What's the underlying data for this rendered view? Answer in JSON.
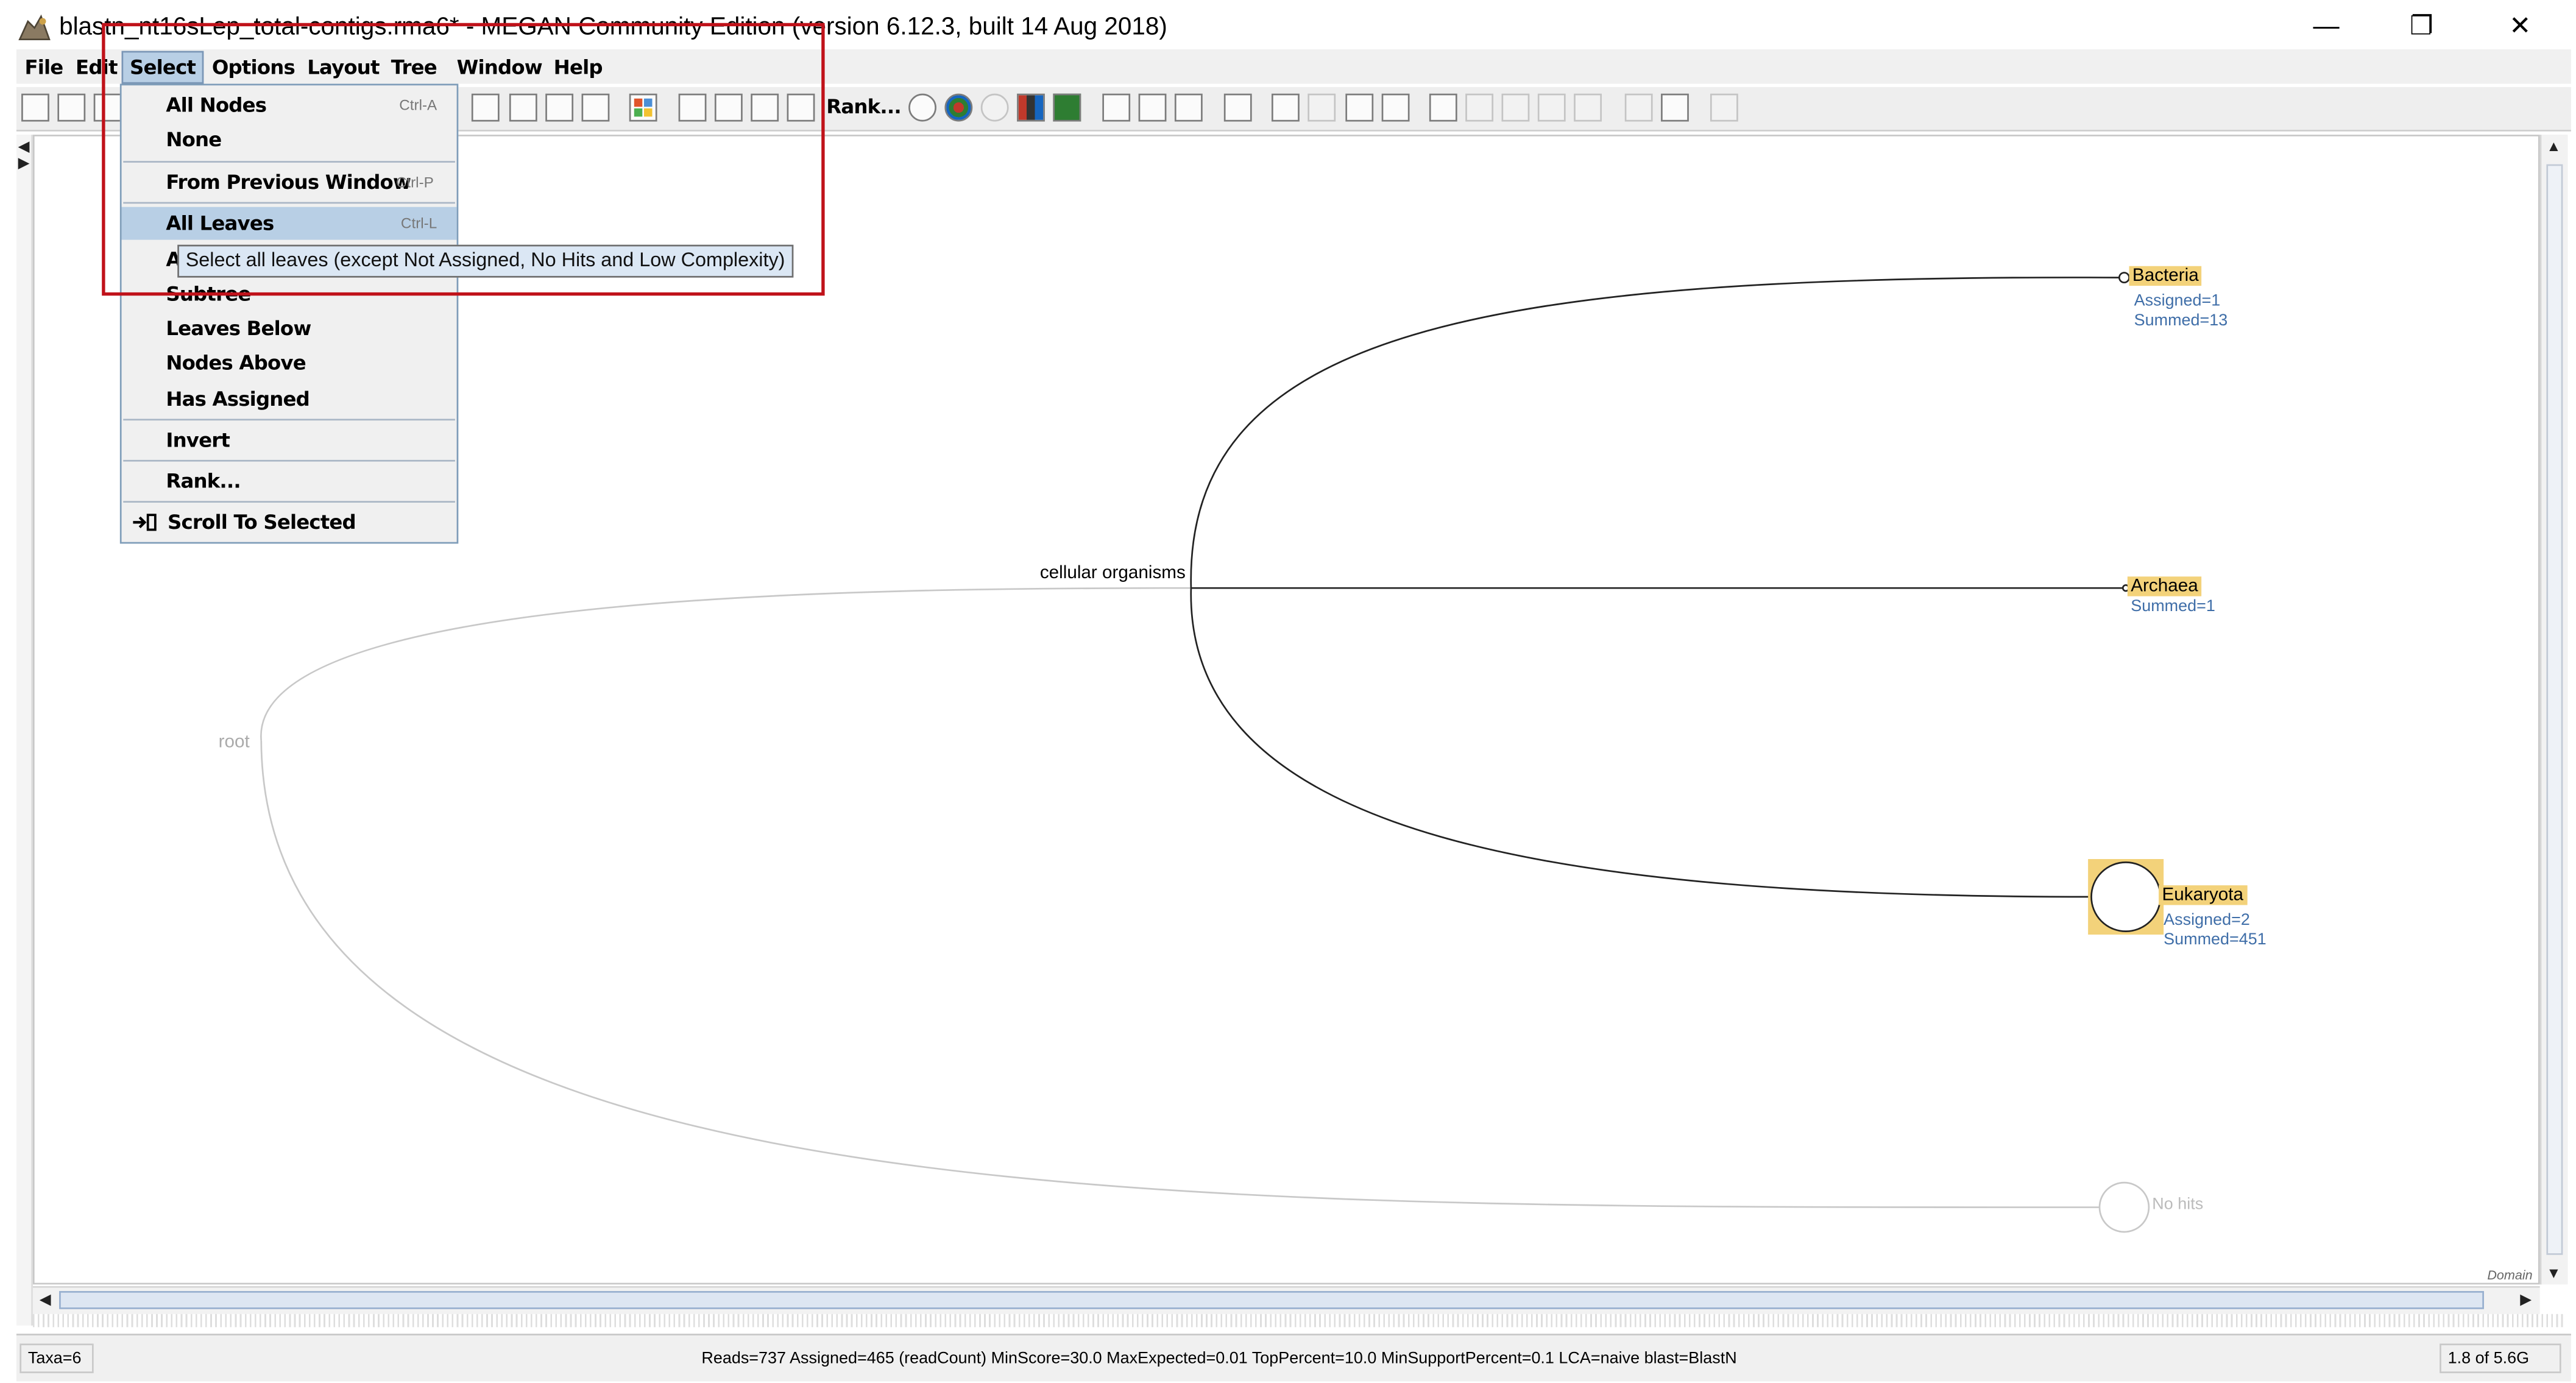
{
  "window": {
    "title": "blastn_nt16sLep_total-contigs.rma6* - MEGAN Community Edition (version 6.12.3, built 14 Aug 2018)",
    "controls": {
      "minimize": "—",
      "maximize": "❐",
      "close": "✕"
    }
  },
  "menubar": {
    "items": [
      {
        "label": "File"
      },
      {
        "label": "Edit"
      },
      {
        "label": "Select",
        "active": true
      },
      {
        "label": "Options"
      },
      {
        "label": "Layout"
      },
      {
        "label": "Tree"
      },
      {
        "label": "Window"
      },
      {
        "label": "Help"
      }
    ]
  },
  "toolbar": {
    "rank_label": "Rank..."
  },
  "select_menu": {
    "items": [
      {
        "label": "All Nodes",
        "accelerator": "Ctrl-A"
      },
      {
        "label": "None",
        "accelerator": ""
      },
      {
        "label": "From Previous Window",
        "accelerator": "Ctrl-P"
      },
      {
        "label": "All Leaves",
        "accelerator": "Ctrl-L",
        "highlighted": true
      },
      {
        "label": "A",
        "accelerator": ""
      },
      {
        "label": "Subtree",
        "accelerator": ""
      },
      {
        "label": "Leaves Below",
        "accelerator": ""
      },
      {
        "label": "Nodes Above",
        "accelerator": ""
      },
      {
        "label": "Has Assigned",
        "accelerator": ""
      },
      {
        "label": "Invert",
        "accelerator": ""
      },
      {
        "label": "Rank...",
        "accelerator": ""
      },
      {
        "label": "Scroll To Selected",
        "accelerator": ""
      }
    ],
    "tooltip": "Select all leaves (except Not Assigned, No Hits and Low Complexity)"
  },
  "tree": {
    "root_label": "root",
    "cellular_label": "cellular organisms",
    "bacteria": {
      "name": "Bacteria",
      "assigned": "Assigned=1",
      "summed": "Summed=13"
    },
    "archaea": {
      "name": "Archaea",
      "summed": "Summed=1"
    },
    "eukaryota": {
      "name": "Eukaryota",
      "assigned": "Assigned=2",
      "summed": "Summed=451"
    },
    "no_hits": {
      "name": "No hits"
    },
    "rank_caption": "Domain"
  },
  "statusbar": {
    "taxa": "Taxa=6",
    "info": "Reads=737 Assigned=465 (readCount) MinScore=30.0 MaxExpected=0.01 TopPercent=10.0 MinSupportPercent=0.1 LCA=naive blast=BlastN",
    "memory": "1.8 of 5.6G"
  },
  "colors": {
    "menu_highlight": "#b8cfe5",
    "node_highlight": "#f3d27a",
    "annotation_box": "#c0121a",
    "info_text": "#3f6ea8"
  }
}
